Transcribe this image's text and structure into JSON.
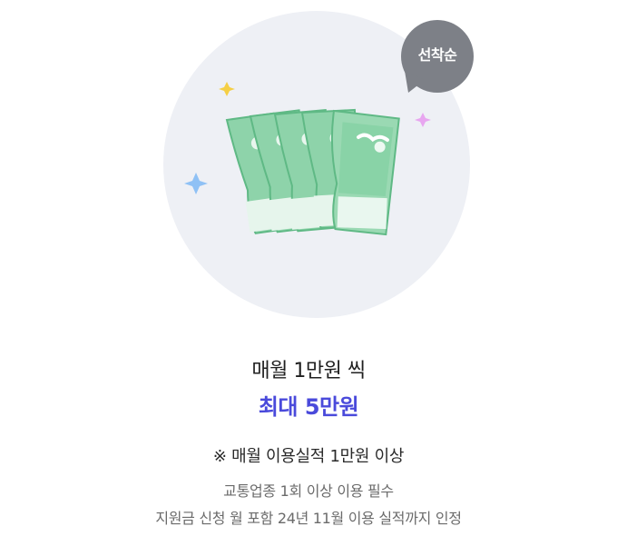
{
  "badge": {
    "label": "선착순"
  },
  "reward": {
    "headline": "매월 1만원 씩",
    "highlight": "최대 5만원"
  },
  "notes": {
    "title": "※ 매월 이용실적 1만원 이상",
    "lines": [
      "교통업종 1회 이상 이용 필수",
      "지원금 신청 월 포함 24년 11월 이용 실적까지 인정"
    ]
  },
  "colors": {
    "accent": "#4a4adb",
    "badge_bg": "#7d8087",
    "circle_bg": "#eef0f5",
    "bill_green": "#7fcf9f",
    "bill_dark": "#5fb985"
  },
  "icons": [
    "money-bills-icon",
    "sparkle-icon",
    "speech-bubble-icon"
  ]
}
